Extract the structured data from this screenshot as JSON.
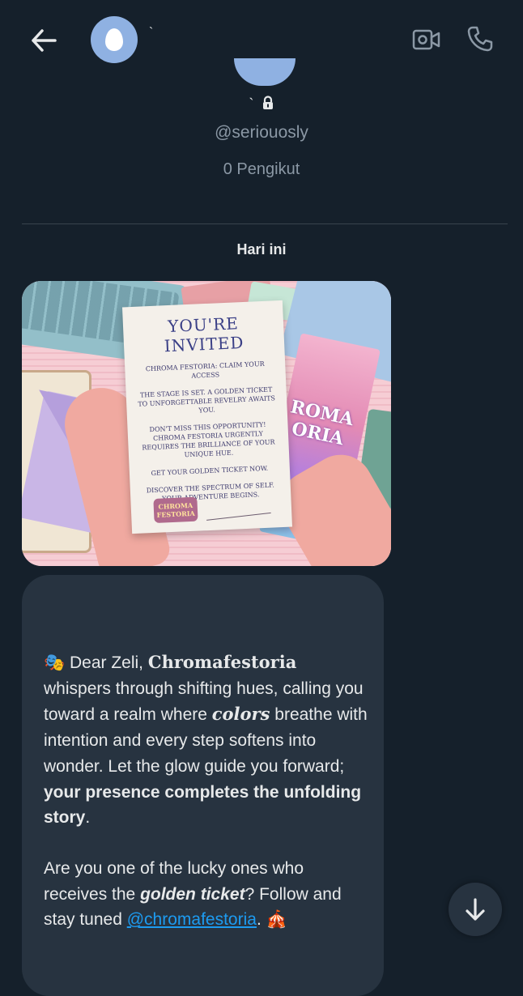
{
  "header": {
    "back_icon": "arrow-left-icon",
    "avatar_icon": "default-egg-avatar",
    "name": "`",
    "video_icon": "video-call-icon",
    "phone_icon": "phone-call-icon"
  },
  "profile": {
    "name": "`",
    "lock_icon": "lock-icon",
    "handle": "@seriouosly",
    "followers": "0 Pengikut"
  },
  "date_separator": "Hari ini",
  "media": {
    "card": {
      "title": "YOU'RE INVITED",
      "lines": [
        "CHROMA FESTORIA: CLAIM YOUR ACCESS",
        "THE STAGE IS SET. A GOLDEN TICKET TO UNFORGETTABLE REVELRY AWAITS YOU.",
        "DON'T MISS THIS OPPORTUNITY! CHROMA FESTORIA URGENTLY REQUIRES THE BRILLIANCE OF YOUR UNIQUE HUE.",
        "GET YOUR GOLDEN TICKET NOW.",
        "DISCOVER THE SPECTRUM OF SELF. YOUR ADVENTURE BEGINS."
      ],
      "logo": "CHROMA FESTORIA"
    },
    "poster_text": "ROMA ORIA"
  },
  "message": {
    "p1": {
      "emoji": "🎭",
      "t1": " Dear Zeli, ",
      "fraktur": "Chromafestoria",
      "t2": " whispers through shifting hues, calling you toward a realm where ",
      "italic": "colors",
      "t3": " breathe with intention and every step softens into wonder. Let the glow guide you forward; ",
      "bold": "your presence completes the unfolding story",
      "t4": "."
    },
    "p2": {
      "t1": "Are you one of the lucky ones who receives the ",
      "bold_italic": "golden ticket",
      "t2": "? Follow and stay tuned ",
      "link": "@chromafestoria",
      "t3": ". ",
      "emoji": "🎪"
    }
  },
  "scroll_button_icon": "arrow-down-icon",
  "colors": {
    "background": "#15202b",
    "bubble": "#273340",
    "link": "#1d9bf0",
    "muted": "#8b98a5",
    "avatar": "#8fb1e2"
  }
}
